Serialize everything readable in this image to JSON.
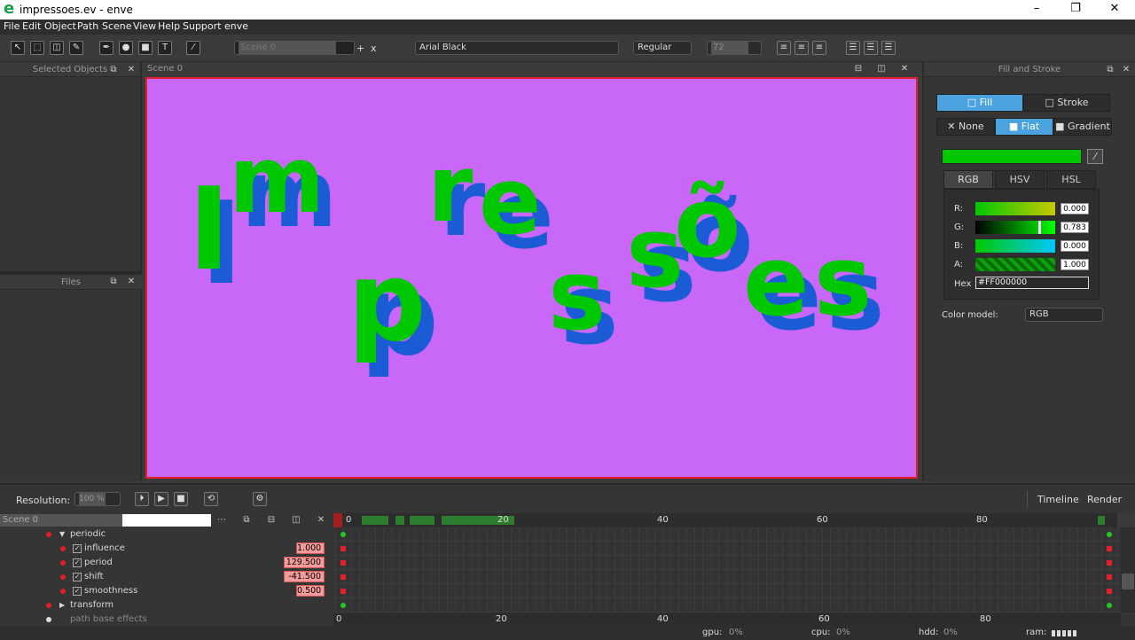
{
  "window": {
    "title": "impressoes.ev - enve",
    "minimize": "–",
    "maximize": "❐",
    "close": "✕"
  },
  "menu": [
    "File",
    "Edit",
    "Object",
    "Path",
    "Scene",
    "View",
    "Help",
    "Support enve"
  ],
  "toolbar": {
    "scene_field": "Scene 0",
    "add": "+",
    "remove": "x",
    "font_family": "Arial Black",
    "font_style": "Regular",
    "font_size": "72"
  },
  "left": {
    "selected_objects": "Selected Objects",
    "files": "Files"
  },
  "scene_header": "Scene 0",
  "canvas": {
    "letters": [
      {
        "ch": "I"
      },
      {
        "ch": "m"
      },
      {
        "ch": "p"
      },
      {
        "ch": "r"
      },
      {
        "ch": "e"
      },
      {
        "ch": "s"
      },
      {
        "ch": "s"
      },
      {
        "ch": "õ"
      },
      {
        "ch": "e"
      },
      {
        "ch": "s"
      }
    ],
    "fill": "#00c800",
    "shadow": "#1c5bd6",
    "background": "#c967f9",
    "border": "#e0202a"
  },
  "fill_stroke": {
    "title": "Fill and Stroke",
    "fill_tab": "Fill",
    "stroke_tab": "Stroke",
    "none": "None",
    "flat": "Flat",
    "gradient": "Gradient",
    "color_preview": "#00c800",
    "model_tabs": [
      "RGB",
      "HSV",
      "HSL"
    ],
    "channels": [
      {
        "label": "R:",
        "value": "0.000"
      },
      {
        "label": "G:",
        "value": "0.783"
      },
      {
        "label": "B:",
        "value": "0.000"
      },
      {
        "label": "A:",
        "value": "1.000"
      }
    ],
    "hex_label": "Hex",
    "hex_value": "#FF000000",
    "color_model_label": "Color model:",
    "color_model_value": "RGB"
  },
  "timeline": {
    "resolution_label": "Resolution:",
    "resolution_value": "100 %",
    "timeline_tab": "Timeline",
    "render_tab": "Render",
    "scene_label": "Scene 0",
    "ruler_top": [
      "0",
      "20",
      "40",
      "60",
      "80"
    ],
    "ruler_bottom": [
      "0",
      "20",
      "40",
      "60",
      "80"
    ],
    "rows": [
      {
        "name": "periodic",
        "expanded": true
      },
      {
        "name": "influence",
        "value": "1.000"
      },
      {
        "name": "period",
        "value": "129.500"
      },
      {
        "name": "shift",
        "value": "-41.500"
      },
      {
        "name": "smoothness",
        "value": "0.500"
      },
      {
        "name": "transform",
        "expanded": false
      },
      {
        "name": "path base effects"
      }
    ],
    "status": {
      "gpu": "gpu:",
      "gpu_val": "0%",
      "cpu": "cpu:",
      "cpu_val": "0%",
      "hdd": "hdd:",
      "hdd_val": "0%",
      "ram": "ram:"
    }
  }
}
